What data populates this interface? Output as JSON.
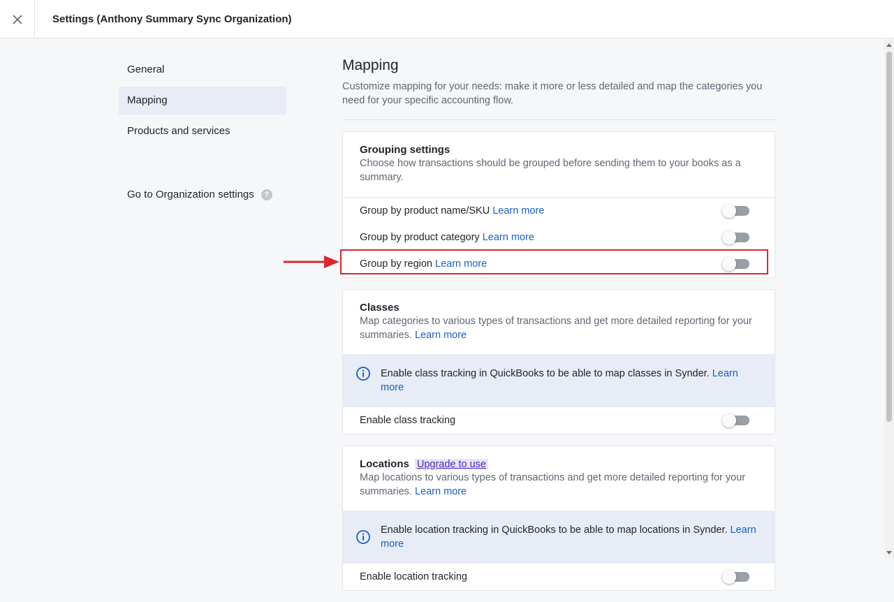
{
  "window": {
    "title": "Settings (Anthony Summary Sync Organization)"
  },
  "sidebar": {
    "items": [
      {
        "label": "General",
        "active": false
      },
      {
        "label": "Mapping",
        "active": true
      },
      {
        "label": "Products and services",
        "active": false
      }
    ],
    "org_link": "Go to Organization settings",
    "help_icon": "?"
  },
  "main": {
    "title": "Mapping",
    "description": "Customize mapping for your needs: make it more or less detailed and map the categories you need for your specific accounting flow."
  },
  "grouping": {
    "title": "Grouping settings",
    "subtitle": "Choose how transactions should be grouped before sending them to your books as a summary.",
    "rows": [
      {
        "label": "Group by product name/SKU",
        "link": "Learn more",
        "enabled": false
      },
      {
        "label": "Group by product category",
        "link": "Learn more",
        "enabled": false
      },
      {
        "label": "Group by region",
        "link": "Learn more",
        "enabled": false
      }
    ]
  },
  "classes": {
    "title": "Classes",
    "subtitle": "Map categories to various types of transactions and get more detailed reporting for your summaries.",
    "subtitle_link": "Learn more",
    "info": "Enable class tracking in QuickBooks to be able to map classes in Synder.",
    "info_link": "Learn more",
    "row_label": "Enable class tracking",
    "enabled": false
  },
  "locations": {
    "title": "Locations",
    "badge": "Upgrade to use",
    "subtitle": "Map locations to various types of transactions and get more detailed reporting for your summaries.",
    "subtitle_link": "Learn more",
    "info": "Enable location tracking in QuickBooks to be able to map locations in Synder.",
    "info_link": "Learn more",
    "row_label": "Enable location tracking",
    "enabled": false
  },
  "colors": {
    "accent": "#1a5fc1",
    "highlight": "#d9282f",
    "info_bg": "#e7ecf6"
  },
  "icons": {
    "close": "close-icon",
    "help": "help-icon",
    "info": "info-icon",
    "arrow": "arrow-right-icon"
  }
}
